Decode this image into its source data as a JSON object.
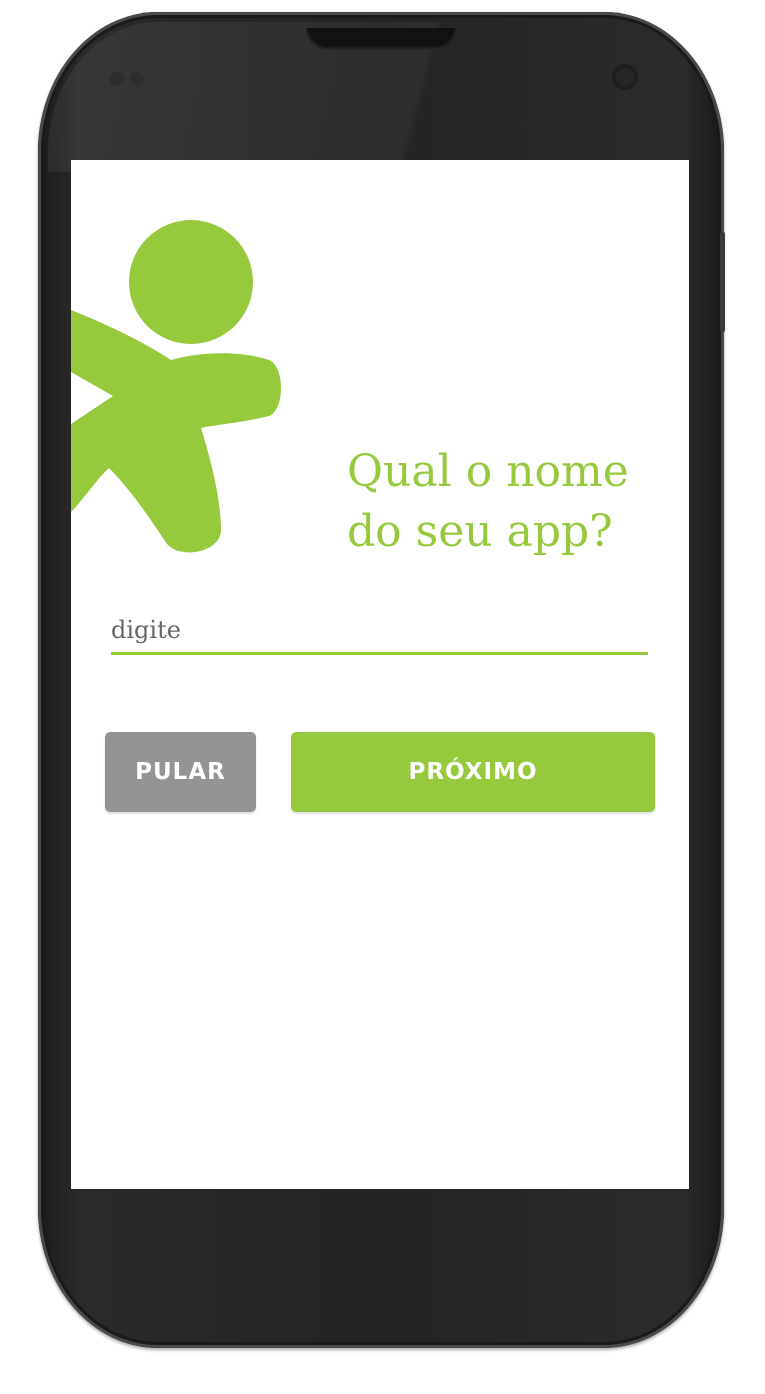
{
  "screen": {
    "question_line1": "Qual o nome",
    "question_line2": "do seu app?",
    "input": {
      "placeholder": "digite",
      "value": ""
    },
    "buttons": {
      "skip_label": "PULAR",
      "next_label": "PRÓXIMO"
    }
  },
  "icons": {
    "mascot": "stick-figure-logo-icon"
  },
  "colors": {
    "accent": "#97c93d",
    "skip_button": "#949494",
    "background": "#ffffff",
    "phone_body": "#242424"
  }
}
